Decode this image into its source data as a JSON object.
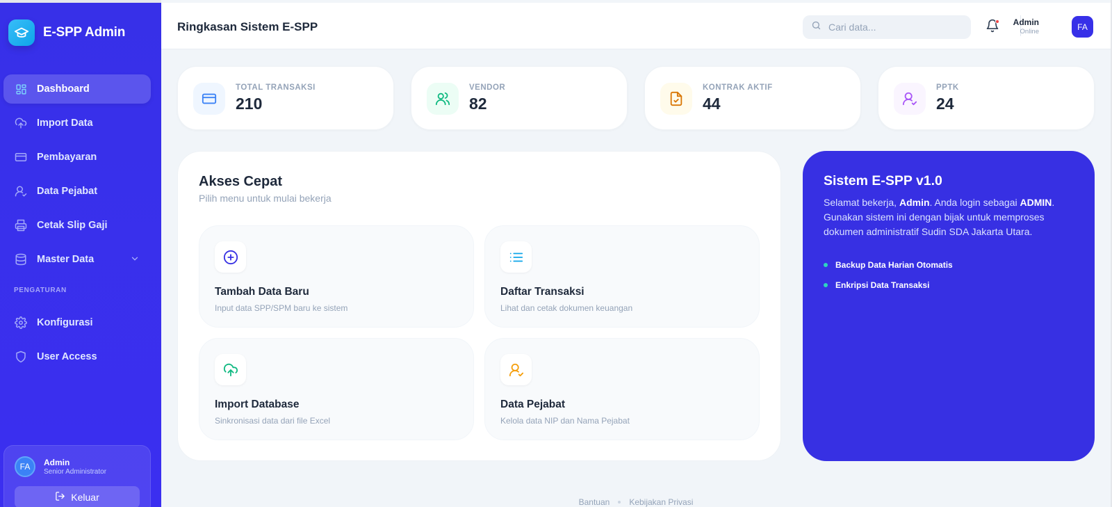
{
  "app": {
    "name": "E-SPP Admin",
    "logo_icon": "graduation-cap-icon"
  },
  "sidebar": {
    "items": [
      {
        "label": "Dashboard",
        "icon": "dashboard-grid-icon",
        "active": true
      },
      {
        "label": "Import Data",
        "icon": "cloud-upload-icon"
      },
      {
        "label": "Pembayaran",
        "icon": "credit-card-icon"
      },
      {
        "label": "Data Pejabat",
        "icon": "user-check-icon"
      },
      {
        "label": "Cetak Slip Gaji",
        "icon": "printer-icon"
      },
      {
        "label": "Master Data",
        "icon": "database-icon"
      }
    ],
    "section_label": "PENGATURAN",
    "settings_items": [
      {
        "label": "Konfigurasi",
        "icon": "gear-icon"
      },
      {
        "label": "User Access",
        "icon": "shield-icon"
      }
    ],
    "profile": {
      "initials": "FA",
      "name": "Admin",
      "role": "Senior Administrator",
      "logout_label": "Keluar"
    }
  },
  "header": {
    "title": "Ringkasan Sistem E-SPP",
    "search_placeholder": "Cari data...",
    "user_name": "Admin",
    "user_status": "Online",
    "user_initials": "FA"
  },
  "stats": [
    {
      "label": "TOTAL TRANSAKSI",
      "value": "210",
      "icon": "credit-card-icon",
      "color": "#3b82f6",
      "bg": "#eff6ff"
    },
    {
      "label": "VENDOR",
      "value": "82",
      "icon": "users-icon",
      "color": "#10b981",
      "bg": "#ecfdf5"
    },
    {
      "label": "KONTRAK AKTIF",
      "value": "44",
      "icon": "file-check-icon",
      "color": "#f59e0b",
      "bg": "#fffbeb"
    },
    {
      "label": "PPTK",
      "value": "24",
      "icon": "user-check-icon",
      "color": "#a855f7",
      "bg": "#faf5ff"
    }
  ],
  "quick_access": {
    "title": "Akses Cepat",
    "subtitle": "Pilih menu untuk mulai bekerja",
    "tiles": [
      {
        "title": "Tambah Data Baru",
        "desc": "Input data SPP/SPM baru ke sistem",
        "icon": "plus-circle-icon",
        "color": "#3730e3"
      },
      {
        "title": "Daftar Transaksi",
        "desc": "Lihat dan cetak dokumen keuangan",
        "icon": "list-icon",
        "color": "#0ea5e9"
      },
      {
        "title": "Import Database",
        "desc": "Sinkronisasi data dari file Excel",
        "icon": "cloud-upload-icon",
        "color": "#10b981"
      },
      {
        "title": "Data Pejabat",
        "desc": "Kelola data NIP dan Nama Pejabat",
        "icon": "user-check-icon",
        "color": "#f59e0b"
      }
    ]
  },
  "info_panel": {
    "title": "Sistem E-SPP v1.0",
    "text_1": "Selamat bekerja, ",
    "user": "Admin",
    "text_2": ". Anda login sebagai ",
    "role": "ADMIN",
    "text_3": ". Gunakan sistem ini dengan bijak untuk memproses dokumen administratif Sudin SDA Jakarta Utara.",
    "features": [
      "Backup Data Harian Otomatis",
      "Enkripsi Data Transaksi"
    ]
  },
  "footer": {
    "links": [
      "Bantuan",
      "Kebijakan Privasi"
    ]
  }
}
